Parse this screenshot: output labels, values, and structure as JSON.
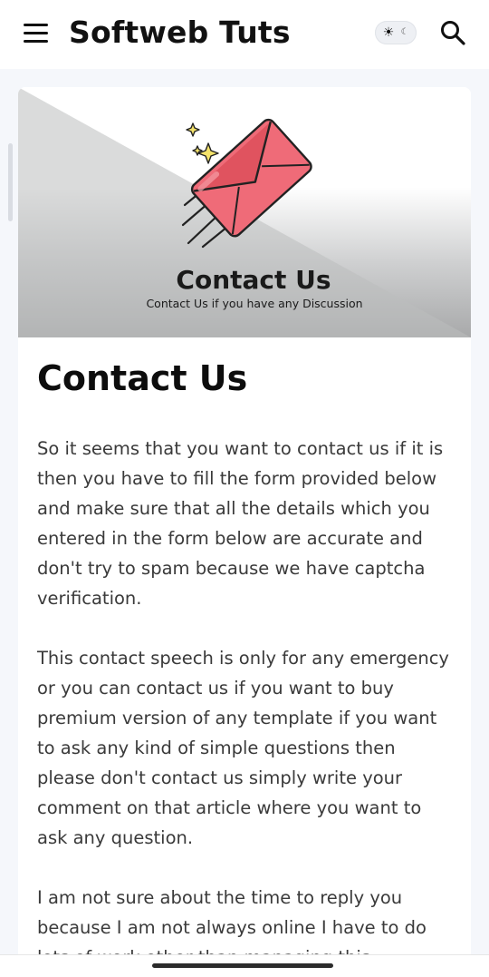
{
  "header": {
    "site_title": "Softweb Tuts",
    "menu_icon": "hamburger-menu-icon",
    "theme_toggle_icons": [
      "sun-icon",
      "moon-icon"
    ],
    "search_icon": "search-icon"
  },
  "hero": {
    "title": "Contact Us",
    "subtitle": "Contact Us if you have any Discussion",
    "image_icon": "envelope-icon",
    "colors": {
      "envelope_fill": "#ef6b78",
      "envelope_stroke": "#222222",
      "sparkle": "#f4e26a"
    }
  },
  "article": {
    "title": "Contact Us",
    "paragraphs": [
      "So it seems that you want to contact us if it is then you have to fill the form provided below and make sure that all the details which you entered in the form below are accurate and don't try to spam because we have captcha verification.",
      "This contact speech is only for any emergency or you can contact us if you want to buy premium version of any template if you want to ask any kind of simple questions then please don't contact us simply write your comment on that article where you want to ask any question.",
      "I am not sure about the time to reply you because I am not always online I have to do lots of work other than managing this"
    ]
  }
}
